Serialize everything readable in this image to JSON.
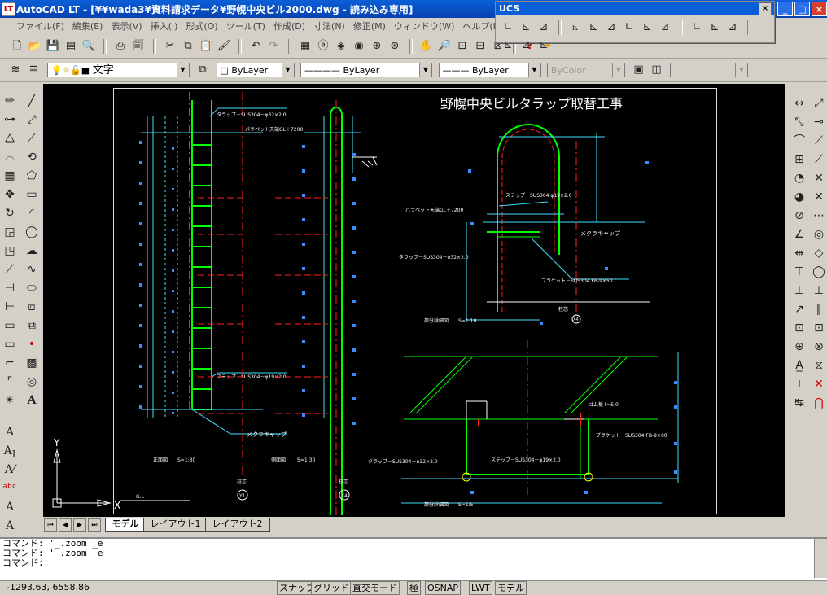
{
  "window": {
    "title": "AutoCAD LT - [¥¥wada3¥資料請求データ¥野幌中央ビル2000.dwg - 読み込み専用]",
    "app_icon": "LT",
    "minimize": "_",
    "maximize": "□",
    "close": "×"
  },
  "menu": [
    "ファイル(F)",
    "編集(E)",
    "表示(V)",
    "挿入(I)",
    "形式(O)",
    "ツール(T)",
    "作成(D)",
    "寸法(N)",
    "修正(M)",
    "ウィンドウ(W)",
    "ヘルプ(H)"
  ],
  "ucs_toolbar": {
    "title": "UCS",
    "close": "×"
  },
  "properties_bar": {
    "layer_value": "文字",
    "color_value": "ByLayer",
    "linetype_value": "ByLayer",
    "lineweight_value": "ByLayer",
    "plotstyle_value": "ByColor"
  },
  "drawing": {
    "title": "野幌中央ビルタラップ取替工事",
    "labels": {
      "tarap_pipe_left": "タラップ－SUS304－φ32×2.0",
      "parapet_left": "パラペット天端GL＋7200",
      "step_left": "ステップ－SUS304－φ19×2.0",
      "mekura_cap_left": "メクラキャップ",
      "front_view": "正面図",
      "front_scale": "S=1:30",
      "side_view": "側面図",
      "side_scale": "S=1:30",
      "column_left": "柱芯",
      "grid_y1": "Y1",
      "grid_x4_left": "X4",
      "step_right": "ステップ－SUS304 φ19×2.0",
      "parapet_right": "パラペット天端GL＋7200",
      "mekura_cap_right": "メクラキャップ",
      "tarap_pipe_right": "タラップ－SUS304－φ32×2.0",
      "bracket_right": "ブラケット－SUS304 FB-9×50",
      "column_right": "柱芯",
      "grid_x4_right": "X4",
      "detail_top": "部分詳細図",
      "detail_top_scale": "S=1:10",
      "gomu": "ゴム板 t=5.0",
      "bracket_plan": "ブラケット－SUS304 FB-9×60",
      "tarap_plan": "タラップ－SUS304－φ32×2.0",
      "step_plan": "ステップ－SUS304－φ19×2.0",
      "detail_bottom": "部分詳細図",
      "detail_bottom_scale": "S=1:5",
      "gl": "G.L",
      "ucs_x": "X",
      "ucs_y": "Y"
    }
  },
  "tabs": [
    "モデル",
    "レイアウト1",
    "レイアウト2"
  ],
  "command": {
    "lines": [
      "コマンド: '_.zoom _e",
      "コマンド: '_.zoom _e",
      "コマンド:"
    ]
  },
  "status": {
    "coords": "-1293.63, 6558.86",
    "buttons": [
      "スナップ",
      "グリッド",
      "直交モード",
      "極",
      "OSNAP",
      "LWT",
      "モデル"
    ]
  },
  "colors": {
    "green": "#00ff00",
    "red": "#ff2020",
    "cyan": "#40e0ff",
    "white": "#ffffff",
    "blue_marker": "#3a8cff"
  }
}
